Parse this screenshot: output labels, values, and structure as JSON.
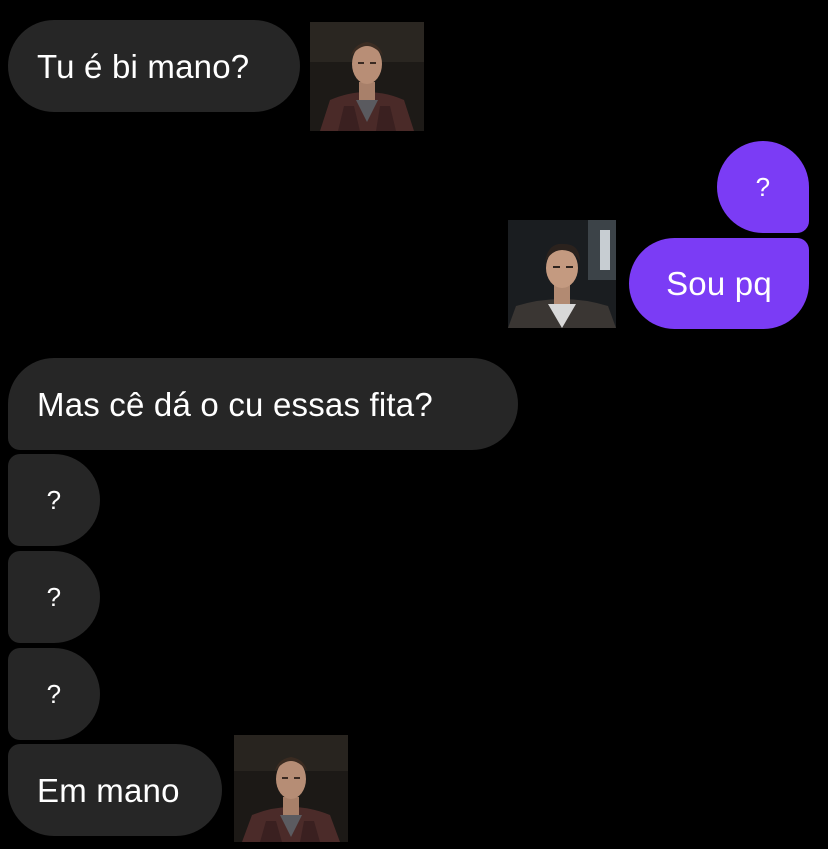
{
  "conversation": {
    "messages": [
      {
        "sender": "them",
        "text": "Tu é bi mano?"
      },
      {
        "sender": "me",
        "text": "?"
      },
      {
        "sender": "me",
        "text": "Sou pq"
      },
      {
        "sender": "them",
        "text": "Mas cê dá o cu essas fita?"
      },
      {
        "sender": "them",
        "text": "?"
      },
      {
        "sender": "them",
        "text": "?"
      },
      {
        "sender": "them",
        "text": "?"
      },
      {
        "sender": "them",
        "text": "Em mano"
      }
    ]
  },
  "colors": {
    "background": "#000000",
    "incoming_bubble": "#262626",
    "outgoing_bubble": "#7b3cf5",
    "text": "#ffffff"
  }
}
